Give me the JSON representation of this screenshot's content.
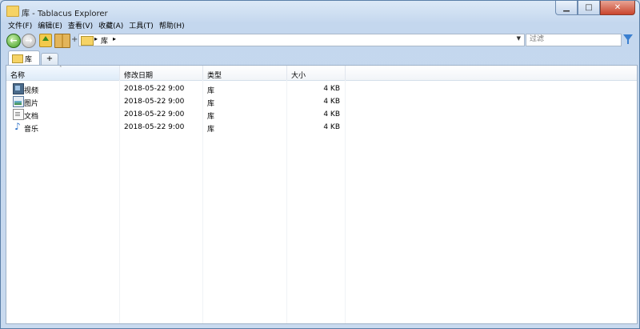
{
  "window": {
    "title": "库 - Tablacus Explorer",
    "buttons": {
      "minimize": "▁",
      "maximize": "□",
      "close": "✕"
    }
  },
  "menu": [
    "文件(F)",
    "编辑(E)",
    "查看(V)",
    "收藏(A)",
    "工具(T)",
    "帮助(H)"
  ],
  "toolbar": {
    "back_icon": "back-arrow-icon",
    "forward_icon": "forward-arrow-icon",
    "up_icon": "folder-up-icon",
    "plus": "+",
    "address": {
      "location": "库",
      "separator": "▸",
      "dropdown": "▼"
    },
    "filter": {
      "placeholder": "过滤"
    }
  },
  "tabs": [
    {
      "label": "库",
      "active": true
    }
  ],
  "tab_add_label": "+",
  "columns": {
    "name": "名称",
    "date": "修改日期",
    "type": "类型",
    "size": "大小",
    "sort_indicator": "ˆ"
  },
  "files": [
    {
      "name": "视频",
      "date": "2018-05-22 9:00",
      "type": "库",
      "size": "4 KB",
      "icon": "video-library-icon"
    },
    {
      "name": "图片",
      "date": "2018-05-22 9:00",
      "type": "库",
      "size": "4 KB",
      "icon": "pictures-library-icon"
    },
    {
      "name": "文档",
      "date": "2018-05-22 9:00",
      "type": "库",
      "size": "4 KB",
      "icon": "documents-library-icon"
    },
    {
      "name": "音乐",
      "date": "2018-05-22 9:00",
      "type": "库",
      "size": "4 KB",
      "icon": "music-library-icon"
    }
  ],
  "colors": {
    "accent": "#3a7fd0",
    "window_frame": "#c9daef",
    "close_button": "#c9452d"
  }
}
